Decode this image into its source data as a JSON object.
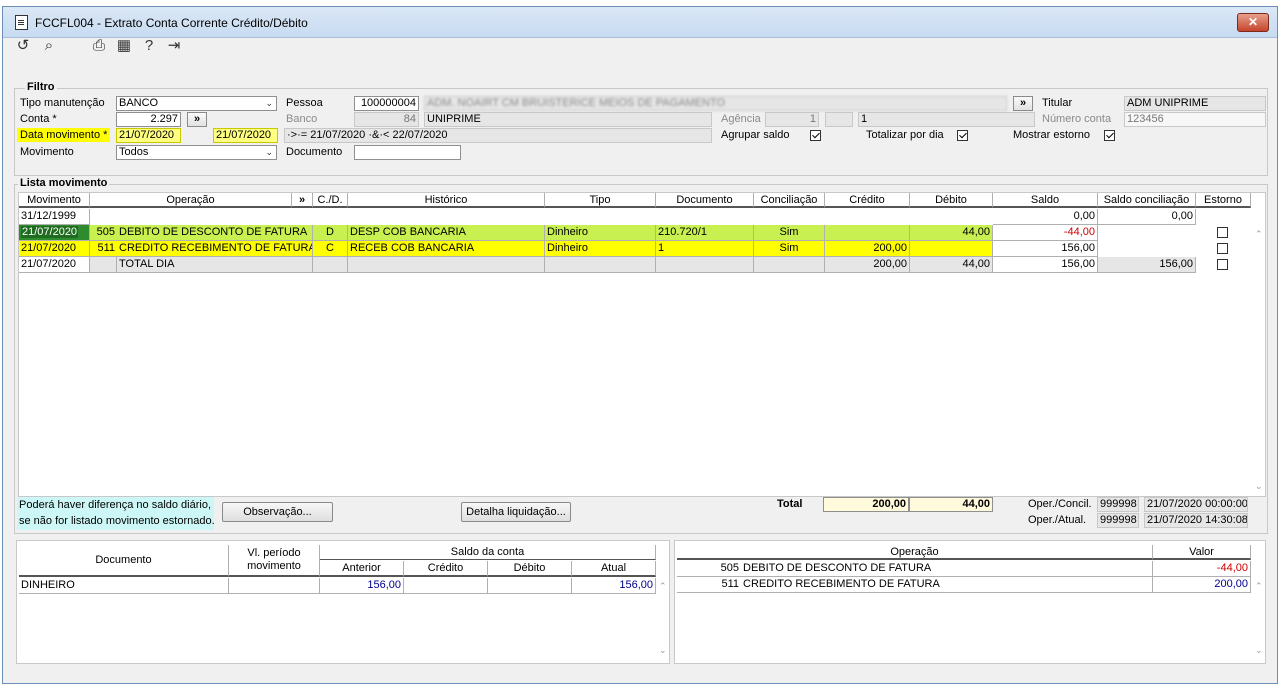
{
  "window": {
    "title": "FCCFL004 - Extrato Conta Corrente Crédito/Débito",
    "close_label": "✕"
  },
  "toolbar": {
    "icons": [
      "refresh-icon",
      "search-icon",
      "print-icon",
      "calendar-icon",
      "help-icon",
      "exit-icon"
    ],
    "glyphs": [
      "↺",
      "⌕",
      "⎙",
      "▦",
      "?",
      "⇥"
    ]
  },
  "filtro": {
    "title": "Filtro",
    "tipo_manutencao_label": "Tipo manutenção",
    "tipo_manutencao_value": "BANCO",
    "conta_label": "Conta *",
    "conta_value": "2.297",
    "data_movimento_label": "Data movimento *",
    "data_from": "21/07/2020",
    "data_to": "21/07/2020",
    "movimento_label": "Movimento",
    "movimento_value": "Todos",
    "pessoa_label": "Pessoa",
    "pessoa_code": "100000004",
    "pessoa_name": "ADM. NOAIRT CM BRUISTERICE MEIOS DE PAGAMENTO",
    "banco_label": "Banco",
    "banco_code": "84",
    "banco_name": "UNIPRIME",
    "agencia_label": "Agência",
    "agencia_value": "1",
    "agencia_digit": "",
    "numero_conta_short": "1",
    "date_expr": "·>·= 21/07/2020 ·&·< 22/07/2020",
    "documento_label": "Documento",
    "documento_value": "",
    "titular_label": "Titular",
    "titular_value": "ADM UNIPRIME",
    "numero_conta_label": "Número conta",
    "numero_conta_value": "123456",
    "agrupar_saldo_label": "Agrupar saldo",
    "totalizar_label": "Totalizar por dia",
    "mostrar_estorno_label": "Mostrar estorno",
    "expand_label": "»"
  },
  "lista": {
    "title": "Lista movimento",
    "headers": [
      "Movimento",
      "Operação",
      "»",
      "C./D.",
      "Histórico",
      "Tipo",
      "Documento",
      "Conciliação",
      "Crédito",
      "Débito",
      "Saldo",
      "Saldo conciliação",
      "Estorno"
    ],
    "rows": [
      {
        "mov": "31/12/1999",
        "op_code": "",
        "op_desc": "",
        "cd": "",
        "hist": "",
        "tipo": "",
        "doc": "",
        "conc": "",
        "cred": "",
        "deb": "",
        "saldo": "0,00",
        "saldo_conc": "0,00",
        "estorno": null
      },
      {
        "mov": "21/07/2020",
        "op_code": "505",
        "op_desc": "DEBITO DE DESCONTO DE FATURA",
        "cd": "D",
        "hist": "DESP  COB  BANCARIA",
        "tipo": "Dinheiro",
        "doc": "210.720/1",
        "conc": "Sim",
        "cred": "",
        "deb": "44,00",
        "saldo": "-44,00",
        "saldo_conc": "",
        "estorno": false
      },
      {
        "mov": "21/07/2020",
        "op_code": "511",
        "op_desc": "CREDITO RECEBIMENTO DE FATURA",
        "cd": "C",
        "hist": "RECEB  COB  BANCARIA",
        "tipo": "Dinheiro",
        "doc": "1",
        "conc": "Sim",
        "cred": "200,00",
        "deb": "",
        "saldo": "156,00",
        "saldo_conc": "",
        "estorno": false
      },
      {
        "mov": "21/07/2020",
        "op_code": "",
        "op_desc": "TOTAL DIA",
        "cd": "",
        "hist": "",
        "tipo": "",
        "doc": "",
        "conc": "",
        "cred": "200,00",
        "deb": "44,00",
        "saldo": "156,00",
        "saldo_conc": "156,00",
        "estorno": false
      }
    ],
    "note_line1": "Poderá haver diferença no saldo diário,",
    "note_line2": "se não for listado movimento estornado.",
    "observacao_label": "Observação...",
    "detalha_label": "Detalha liquidação...",
    "total_label": "Total",
    "total_credito": "200,00",
    "total_debito": "44,00",
    "oper_concil_label": "Oper./Concil.",
    "oper_concil_user": "999998",
    "oper_concil_date": "21/07/2020 00:00:00",
    "oper_atual_label": "Oper./Atual.",
    "oper_atual_user": "999998",
    "oper_atual_date": "21/07/2020 14:30:08"
  },
  "saldo_grid": {
    "h_documento": "Documento",
    "h_vl_periodo": "Vl. período movimento",
    "h_saldo": "Saldo da conta",
    "h_anterior": "Anterior",
    "h_credito": "Crédito",
    "h_debito": "Débito",
    "h_atual": "Atual",
    "rows": [
      {
        "doc": "DINHEIRO",
        "vl": "",
        "anterior": "156,00",
        "credito": "",
        "debito": "",
        "atual": "156,00"
      }
    ]
  },
  "operacao_grid": {
    "h_operacao": "Operação",
    "h_valor": "Valor",
    "rows": [
      {
        "code": "505",
        "desc": "DEBITO DE DESCONTO DE FATURA",
        "valor": "-44,00"
      },
      {
        "code": "511",
        "desc": "CREDITO RECEBIMENTO DE FATURA",
        "valor": "200,00"
      }
    ]
  },
  "colors": {
    "highlight_yellow": "#ffff00",
    "selected_green": "#c8f050",
    "negative": "#d00000",
    "total_bg": "#fffadc"
  }
}
